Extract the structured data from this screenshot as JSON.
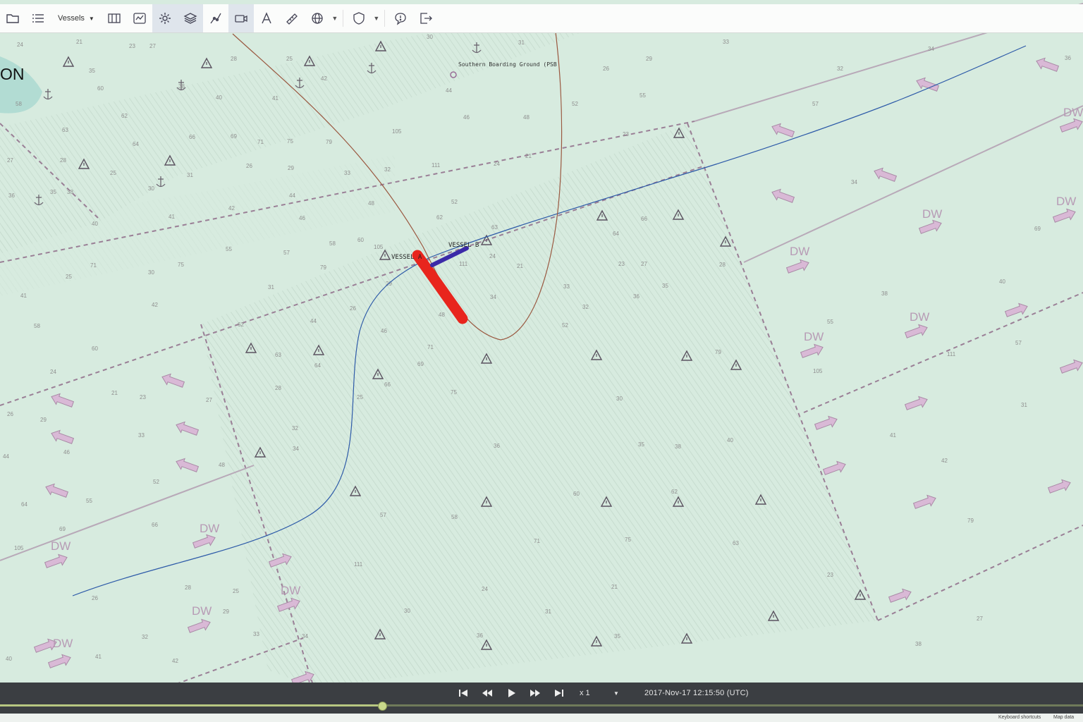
{
  "toolbar": {
    "vessels_label": "Vessels",
    "icons": [
      "folder-icon",
      "list-icon",
      "vessels-dropdown",
      "map-book-icon",
      "chart-catalog-icon",
      "settings-gear-icon",
      "layers-icon",
      "route-icon",
      "camera-icon",
      "text-tool-icon",
      "ruler-icon",
      "globe-icon",
      "globe-caret",
      "shield-icon",
      "shield-caret",
      "chat-icon",
      "exit-icon"
    ]
  },
  "map": {
    "region_label": "ON",
    "vessel_a_label": "VESSEL A",
    "vessel_b_label": "VESSEL B",
    "pilot_station_label": "Southern Boarding Ground (PSB",
    "deep_water_label": "DW",
    "colors": {
      "sea": "#d7ebdf",
      "hatch": "#c5d9cd",
      "route_line": "#2d5aa8",
      "own_track": "#9a5840",
      "vessel_a": "#e8251d",
      "vessel_b": "#3b2aa8",
      "traffic_arrow": "#c7a9c7",
      "tss_border": "#9a8a9a"
    },
    "depth_soundings": [
      "24",
      "21",
      "23",
      "27",
      "28",
      "25",
      "30",
      "31",
      "26",
      "29",
      "33",
      "32",
      "34",
      "36",
      "35",
      "38",
      "40",
      "41",
      "42",
      "44",
      "46",
      "48",
      "52",
      "55",
      "57",
      "58",
      "60",
      "62",
      "63",
      "64",
      "66",
      "69",
      "71",
      "75",
      "79",
      "105",
      "111"
    ]
  },
  "playback": {
    "skip_start_icon": "skip-to-start-icon",
    "rewind_icon": "rewind-icon",
    "play_icon": "play-icon",
    "fast_forward_icon": "fast-forward-icon",
    "skip_end_icon": "skip-to-end-icon",
    "speed": "x 1",
    "timestamp": "2017-Nov-17 12:15:50 (UTC)",
    "progress": 0.352
  },
  "footer": {
    "keyboard_shortcuts": "Keyboard shortcuts",
    "map_data": "Map data"
  }
}
